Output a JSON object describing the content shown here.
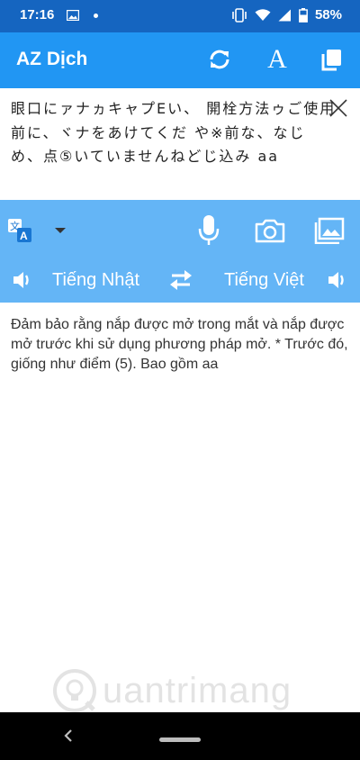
{
  "status_bar": {
    "time": "17:16",
    "battery": "58%",
    "icons": [
      "image-icon",
      "dot-icon",
      "vibrate-icon",
      "wifi-icon",
      "signal-icon",
      "battery-icon"
    ]
  },
  "app_bar": {
    "title": "AZ Dịch",
    "actions": [
      "refresh-icon",
      "font-icon",
      "copy-icon"
    ],
    "font_glyph": "A"
  },
  "source": {
    "text": "眼口にァナヵキャプEい、  開栓方法ゥご使用前に、ヾナをあけてくだ  や※前な、なじめ、点⑤いていませんねどじ込み  aa"
  },
  "toolbar": {
    "icons": [
      "translate-icon",
      "dropdown-icon",
      "microphone-icon",
      "camera-icon",
      "gallery-icon"
    ],
    "source_lang": "Tiếng Nhật",
    "target_lang": "Tiếng Việt"
  },
  "result": {
    "text": "Đảm bảo rằng nắp được mở trong mắt và nắp được mở trước khi sử dụng phương pháp mở. * Trước đó, giống như điểm (5).  Bao gồm aa"
  },
  "watermark": {
    "text": "uantrimang"
  },
  "colors": {
    "status_bar": "#1565c0",
    "app_bar": "#2196f3",
    "toolbar": "#64b5f6",
    "nav_bar": "#000000"
  }
}
